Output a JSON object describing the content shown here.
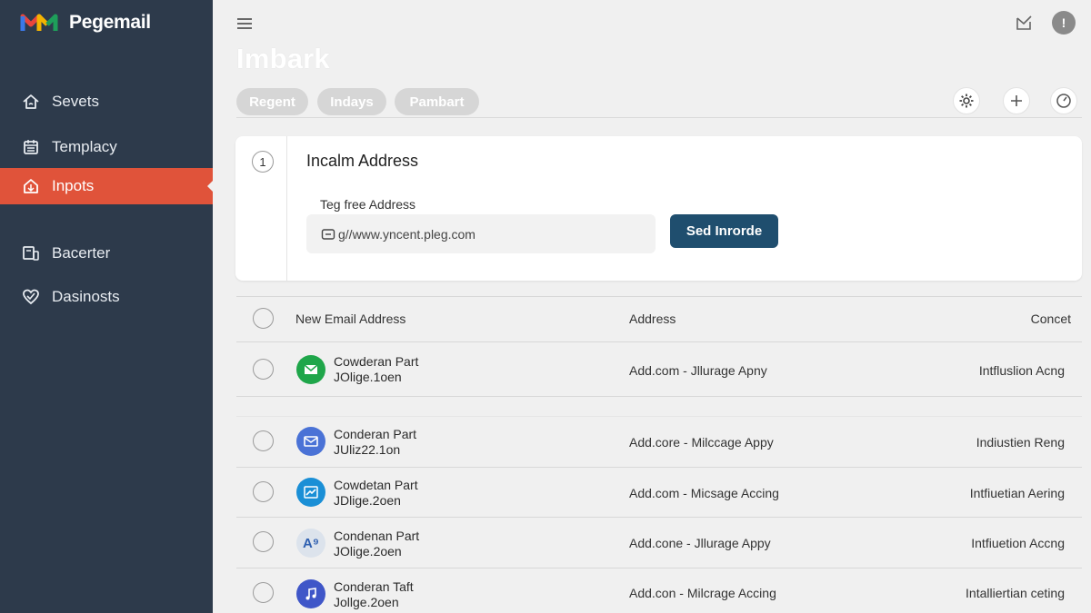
{
  "app": {
    "name": "Pegemail"
  },
  "colors": {
    "sidebar": "#2d3a4b",
    "active": "#e0533a",
    "primary_button": "#1f4e6e"
  },
  "sidebar": {
    "items": [
      {
        "label": "Sevets",
        "icon": "home-icon"
      },
      {
        "label": "Templacy",
        "icon": "calendar-icon"
      },
      {
        "label": "Inpots",
        "icon": "inbox-icon",
        "active": true
      },
      {
        "label": "Bacerter",
        "icon": "devices-icon"
      },
      {
        "label": "Dasinosts",
        "icon": "heart-icon"
      }
    ]
  },
  "header": {
    "title": "Imbark",
    "chips": [
      "Regent",
      "Indays",
      "Pambart"
    ],
    "info_label": "!"
  },
  "card": {
    "step": "1",
    "title": "Incalm Address",
    "field_label": "Teg free Address",
    "field_value": "g//www.yncent.pleg.com",
    "button_label": "Sed Inrorde"
  },
  "table": {
    "headers": [
      "New Email Address",
      "Address",
      "Concet"
    ],
    "rows": [
      {
        "name": "Cowderan Part",
        "sub": "JOlige.1oen",
        "address": "Add.com  -  Jllurage Apny",
        "contact": "Intfluslion Acng",
        "avatar_color": "#1fa64a",
        "icon": "email-icon"
      },
      {
        "name": "Conderan Part",
        "sub": "JUliz22.1on",
        "address": "Add.core  -  Milccage Appy",
        "contact": "Indiustien Reng",
        "avatar_color": "#4a72d6",
        "icon": "mail-icon"
      },
      {
        "name": "Cowdetan Part",
        "sub": "JDlige.2oen",
        "address": "Add.com  -  Micsage Accing",
        "contact": "Intfiuetian Aering",
        "avatar_color": "#1a8fd6",
        "icon": "chart-icon"
      },
      {
        "name": "Condenan Part",
        "sub": "JOlige.2oen",
        "address": "Add.cone  -  Jllurage Appy",
        "contact": "Intfiuetion Accng",
        "avatar_color": "#dce3ec",
        "icon": "translate-icon",
        "icon_text": "A⁹"
      },
      {
        "name": "Conderan Taft",
        "sub": "Jollge.2oen",
        "address": "Add.con  -  Milcrage Accing",
        "contact": "Intalliertian ceting",
        "avatar_color": "#3f56c8",
        "icon": "music-icon"
      }
    ]
  }
}
